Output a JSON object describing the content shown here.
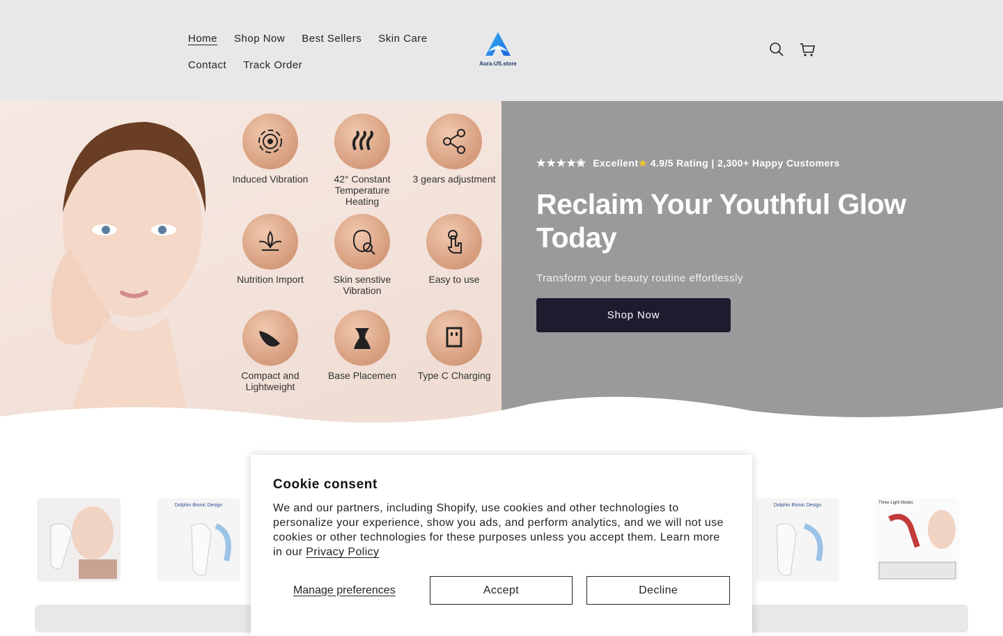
{
  "nav": {
    "row1": [
      {
        "label": "Home",
        "active": true
      },
      {
        "label": "Shop Now"
      },
      {
        "label": "Best Sellers"
      },
      {
        "label": "Skin Care"
      }
    ],
    "row2": [
      {
        "label": "Contact"
      },
      {
        "label": "Track Order"
      }
    ]
  },
  "logo": {
    "text": "Aura-US.store",
    "icon": "aura-logo-icon"
  },
  "header_icons": [
    "search-icon",
    "cart-icon"
  ],
  "hero": {
    "stars": "★★★★✬",
    "rating_prefix": "Excellent",
    "rating_star": "★",
    "rating_text": "4.9/5 Rating | 2,300+ Happy Customers",
    "title": "Reclaim Your Youthful Glow Today",
    "subtitle": "Transform your beauty routine effortlessly",
    "button": "Shop Now",
    "features": [
      {
        "label": "Induced Vibration",
        "icon": "vibration-icon"
      },
      {
        "label": "42° Constant Temperature Heating",
        "icon": "heat-icon"
      },
      {
        "label": "3 gears adjustment",
        "icon": "share-nodes-icon"
      },
      {
        "label": "Nutrition Import",
        "icon": "lotus-icon"
      },
      {
        "label": "Skin senstive Vibration",
        "icon": "face-scan-icon"
      },
      {
        "label": "Easy to use",
        "icon": "touch-icon"
      },
      {
        "label": "Compact and Lightweight",
        "icon": "feather-icon"
      },
      {
        "label": "Base Placemen",
        "icon": "base-stand-icon"
      },
      {
        "label": "Type C Charging",
        "icon": "usb-c-icon"
      }
    ]
  },
  "thumbnails": [
    {
      "caption": ""
    },
    {
      "caption": "Dolphin Bionic Design"
    },
    {
      "caption": "Dolphin Bionic Design"
    },
    {
      "caption": "Three Light Modes"
    }
  ],
  "cookie": {
    "title": "Cookie consent",
    "body": "We and our partners, including Shopify, use cookies and other technologies to personalize your experience, show you ads, and perform analytics, and we will not use cookies or other technologies for these purposes unless you accept them. Learn more in our ",
    "link": "Privacy Policy",
    "manage": "Manage preferences",
    "accept": "Accept",
    "decline": "Decline"
  },
  "colors": {
    "header_bg": "#e8e8ea",
    "hero_bg": "#9a9a9c",
    "button_bg": "#1d1b2e",
    "accent_gold": "#f4c430",
    "logo_blue": "#1a8fe3"
  }
}
